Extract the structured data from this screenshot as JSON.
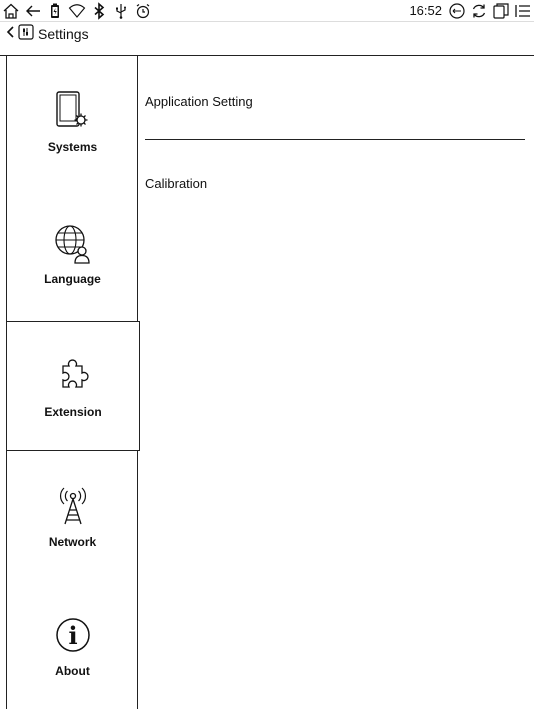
{
  "status_bar": {
    "time": "16:52",
    "icons": [
      "home-icon",
      "back-arrow-icon",
      "battery-icon",
      "wifi-icon",
      "bluetooth-icon",
      "usb-icon",
      "alarm-icon",
      "refresh-mode-icon",
      "sync-icon",
      "multitask-icon",
      "menu-icon"
    ]
  },
  "title_bar": {
    "title": "Settings"
  },
  "sidebar": {
    "items": [
      {
        "label": "Systems",
        "icon": "systems-icon"
      },
      {
        "label": "Language",
        "icon": "globe-user-icon"
      },
      {
        "label": "Extension",
        "icon": "puzzle-icon",
        "selected": true
      },
      {
        "label": "Network",
        "icon": "antenna-icon"
      },
      {
        "label": "About",
        "icon": "info-icon"
      }
    ]
  },
  "content": {
    "rows": [
      "Application Setting",
      "Calibration"
    ]
  }
}
